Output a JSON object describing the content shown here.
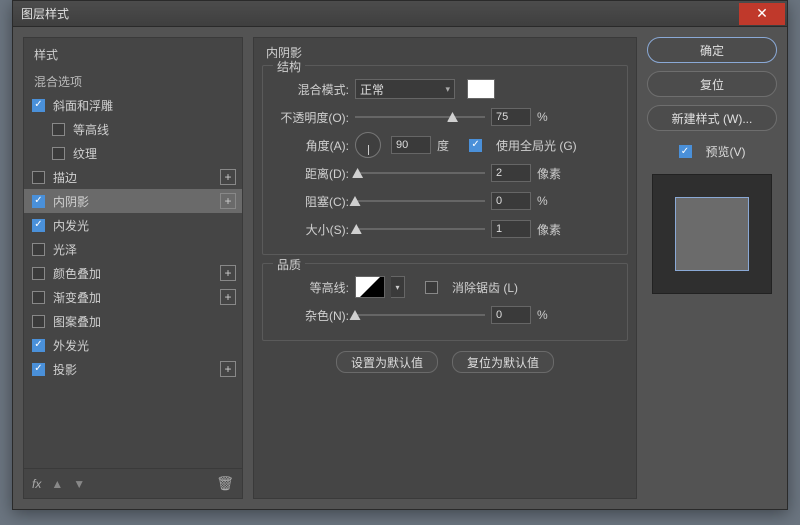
{
  "window": {
    "title": "图层样式"
  },
  "left": {
    "header": "样式",
    "blend_options": "混合选项",
    "items": [
      {
        "label": "斜面和浮雕",
        "checked": true,
        "plus": false,
        "indent": false
      },
      {
        "label": "等高线",
        "checked": false,
        "plus": false,
        "indent": true
      },
      {
        "label": "纹理",
        "checked": false,
        "plus": false,
        "indent": true
      },
      {
        "label": "描边",
        "checked": false,
        "plus": true,
        "indent": false
      },
      {
        "label": "内阴影",
        "checked": true,
        "plus": true,
        "indent": false,
        "selected": true
      },
      {
        "label": "内发光",
        "checked": true,
        "plus": false,
        "indent": false
      },
      {
        "label": "光泽",
        "checked": false,
        "plus": false,
        "indent": false
      },
      {
        "label": "颜色叠加",
        "checked": false,
        "plus": true,
        "indent": false
      },
      {
        "label": "渐变叠加",
        "checked": false,
        "plus": true,
        "indent": false
      },
      {
        "label": "图案叠加",
        "checked": false,
        "plus": false,
        "indent": false
      },
      {
        "label": "外发光",
        "checked": true,
        "plus": false,
        "indent": false
      },
      {
        "label": "投影",
        "checked": true,
        "plus": true,
        "indent": false
      }
    ],
    "fx": "fx"
  },
  "center": {
    "title": "内阴影",
    "structure": {
      "legend": "结构",
      "blend_mode_label": "混合模式:",
      "blend_mode_value": "正常",
      "opacity_label": "不透明度(O):",
      "opacity_value": "75",
      "percent": "%",
      "angle_label": "角度(A):",
      "angle_value": "90",
      "degree": "度",
      "use_global_label": "使用全局光 (G)",
      "use_global_checked": true,
      "distance_label": "距离(D):",
      "distance_value": "2",
      "pixel": "像素",
      "choke_label": "阻塞(C):",
      "choke_value": "0",
      "size_label": "大小(S):",
      "size_value": "1"
    },
    "quality": {
      "legend": "品质",
      "contour_label": "等高线:",
      "antialias_label": "消除锯齿 (L)",
      "noise_label": "杂色(N):",
      "noise_value": "0",
      "percent": "%"
    },
    "buttons": {
      "set_default": "设置为默认值",
      "reset_default": "复位为默认值"
    }
  },
  "right": {
    "ok": "确定",
    "reset": "复位",
    "new_style": "新建样式 (W)...",
    "preview": "预览(V)"
  }
}
